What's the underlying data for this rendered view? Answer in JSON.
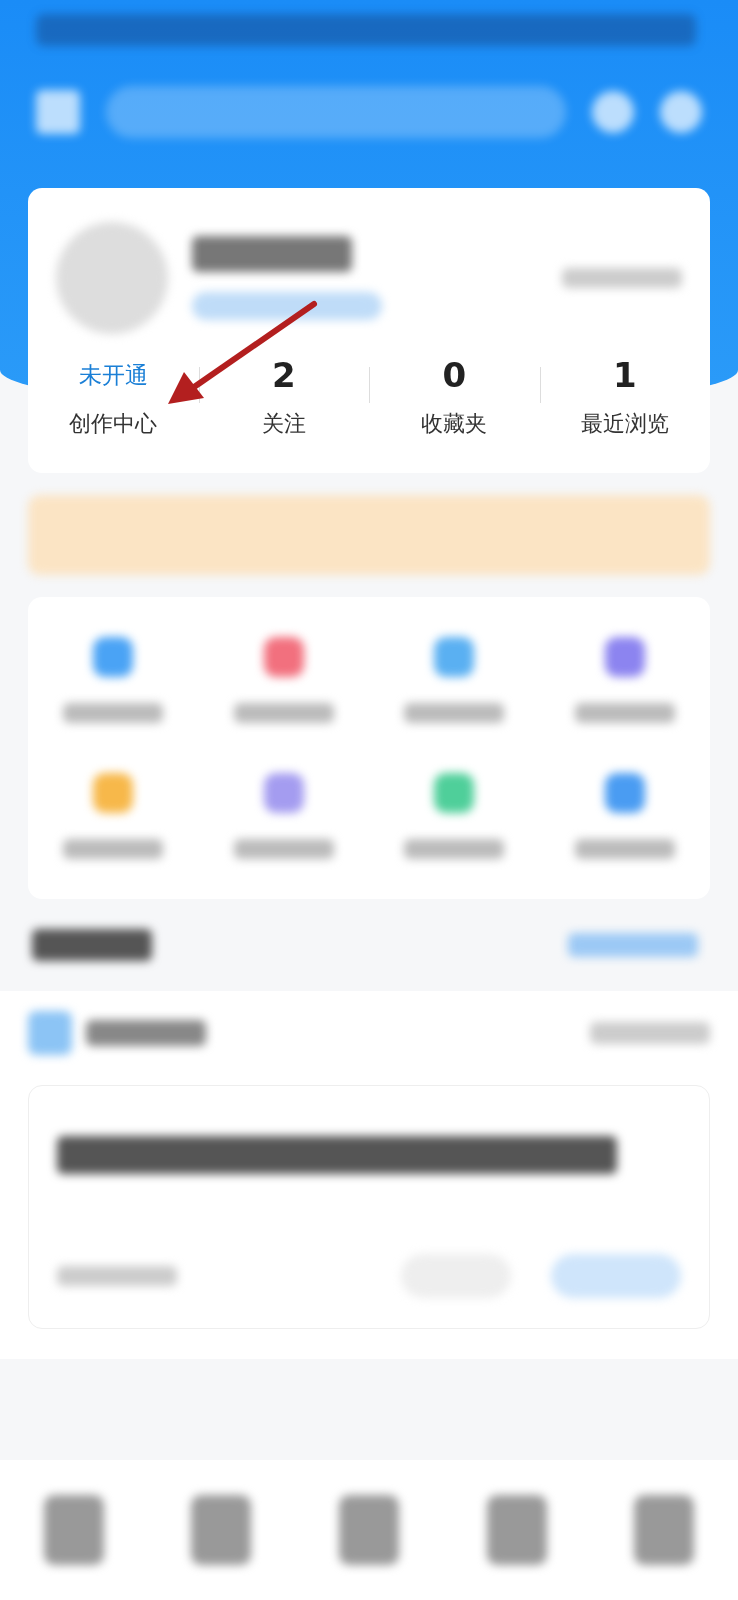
{
  "stats": [
    {
      "kind": "status",
      "value": "未开通",
      "label": "创作中心"
    },
    {
      "kind": "count",
      "value": "2",
      "label": "关注"
    },
    {
      "kind": "count",
      "value": "0",
      "label": "收藏夹"
    },
    {
      "kind": "count",
      "value": "1",
      "label": "最近浏览"
    }
  ]
}
